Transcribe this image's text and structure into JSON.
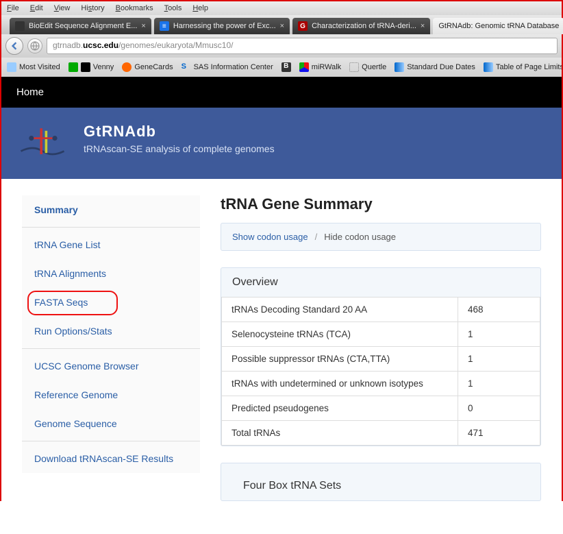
{
  "menu": {
    "file": "File",
    "edit": "Edit",
    "view": "View",
    "history": "History",
    "bookmarks": "Bookmarks",
    "tools": "Tools",
    "help": "Help"
  },
  "tabs": [
    {
      "label": "BioEdit Sequence Alignment E...",
      "active": false
    },
    {
      "label": "Harnessing the power of Exc...",
      "active": false
    },
    {
      "label": "Characterization of tRNA-deri...",
      "active": false
    },
    {
      "label": "GtRNAdb: Genomic tRNA Database",
      "active": true
    }
  ],
  "url": {
    "host": "ucsc.edu",
    "prefix": "gtrnadb.",
    "path": "/genomes/eukaryota/Mmusc10/"
  },
  "bookmarks": [
    "Most Visited",
    "Venny",
    "GeneCards",
    "SAS Information Center",
    "miRWalk",
    "Quertle",
    "Standard Due Dates",
    "Table of Page Limits"
  ],
  "page": {
    "home": "Home",
    "title": "GtRNAdb",
    "subtitle": "tRNAscan-SE analysis of complete genomes"
  },
  "sidebar": {
    "items": [
      "Summary",
      "tRNA Gene List",
      "tRNA Alignments",
      "FASTA Seqs",
      "Run Options/Stats",
      "UCSC Genome Browser",
      "Reference Genome",
      "Genome Sequence",
      "Download tRNAscan-SE Results"
    ]
  },
  "main": {
    "heading": "tRNA Gene Summary",
    "codon_show": "Show codon usage",
    "codon_hide": "Hide codon usage",
    "overview_title": "Overview",
    "rows": [
      {
        "label": "tRNAs Decoding Standard 20 AA",
        "value": "468"
      },
      {
        "label": "Selenocysteine tRNAs (TCA)",
        "value": "1"
      },
      {
        "label": "Possible suppressor tRNAs (CTA,TTA)",
        "value": "1"
      },
      {
        "label": "tRNAs with undetermined or unknown isotypes",
        "value": "1"
      },
      {
        "label": "Predicted pseudogenes",
        "value": "0"
      },
      {
        "label": "Total tRNAs",
        "value": "471"
      }
    ],
    "next_panel": "Four Box tRNA Sets"
  }
}
